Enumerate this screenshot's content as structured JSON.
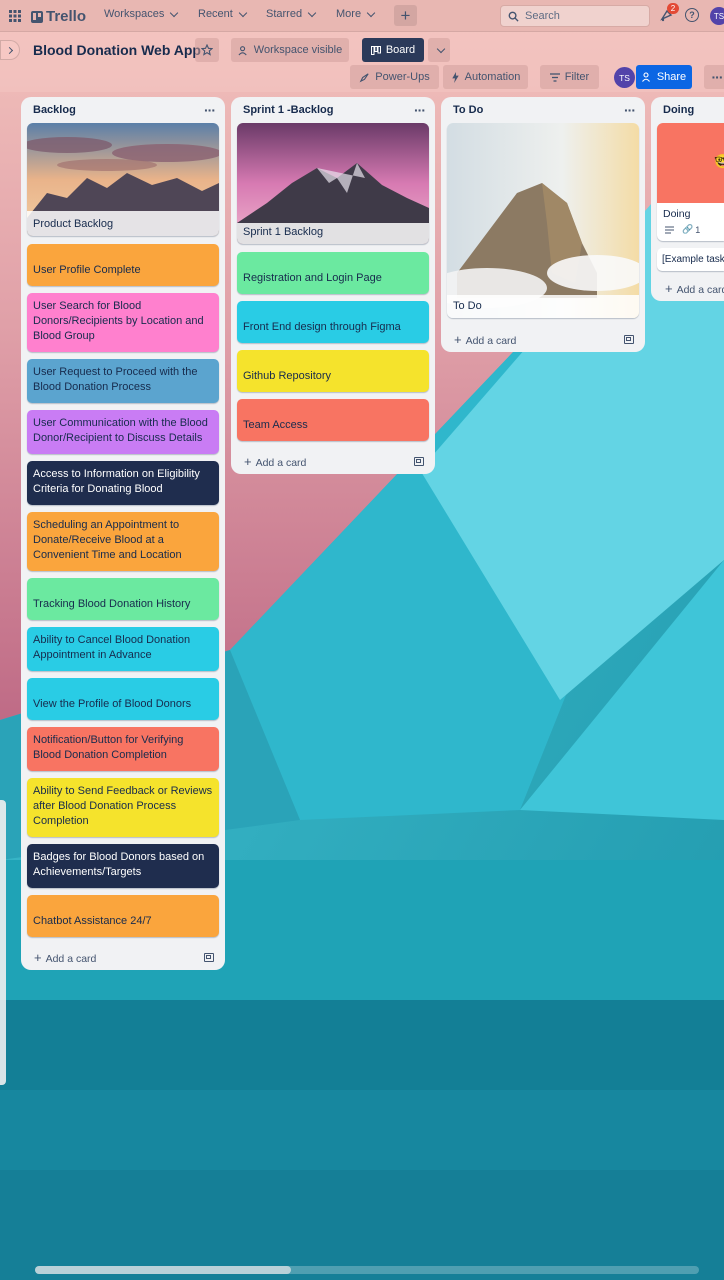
{
  "nav": {
    "brand": "Trello",
    "workspaces": "Workspaces",
    "recent": "Recent",
    "starred": "Starred",
    "more": "More",
    "search_placeholder": "Search",
    "notification_count": "2",
    "avatar_initials": "TS"
  },
  "board": {
    "title": "Blood Donation Web App",
    "visibility": "Workspace visible",
    "view": "Board",
    "power_ups": "Power-Ups",
    "automation": "Automation",
    "filter": "Filter",
    "member_initials": "TS",
    "share": "Share"
  },
  "lists": [
    {
      "title": "Backlog",
      "cover_label": "Product Backlog",
      "cards": [
        {
          "text": "User Profile Complete",
          "color": "#faa53d"
        },
        {
          "text": "User Search for Blood Donors/Recipients by Location and Blood Group",
          "color": "#ff80ce"
        },
        {
          "text": "User Request to Proceed with the Blood Donation Process",
          "color": "#5ba4cf"
        },
        {
          "text": "User Communication with the Blood Donor/Recipient to Discuss Details",
          "color": "#c97cf4"
        },
        {
          "text": "Access to Information on Eligibility Criteria for Donating Blood",
          "color": "#1f2d4e"
        },
        {
          "text": "Scheduling an Appointment to Donate/Receive Blood at a Convenient Time and Location",
          "color": "#faa53d"
        },
        {
          "text": "Tracking Blood Donation History",
          "color": "#6be9a0"
        },
        {
          "text": "Ability to Cancel Blood Donation Appointment in Advance",
          "color": "#29cce5"
        },
        {
          "text": "View the Profile of Blood Donors",
          "color": "#29cce5"
        },
        {
          "text": "Notification/Button for Verifying Blood Donation Completion",
          "color": "#f87462"
        },
        {
          "text": "Ability to Send Feedback or Reviews after Blood Donation Process Completion",
          "color": "#f5e32c"
        },
        {
          "text": "Badges for Blood Donors based on Achievements/Targets",
          "color": "#1f2d4e"
        },
        {
          "text": "Chatbot Assistance 24/7",
          "color": "#faa53d"
        }
      ],
      "add_label": "Add a card"
    },
    {
      "title": "Sprint 1 -Backlog",
      "cover_label": "Sprint 1 Backlog",
      "cards": [
        {
          "text": "Registration and Login Page",
          "color": "#6be9a0"
        },
        {
          "text": "Front End design through Figma",
          "color": "#29cce5"
        },
        {
          "text": "Github Repository",
          "color": "#f5e32c"
        },
        {
          "text": "Team Access",
          "color": "#f87462"
        }
      ],
      "add_label": "Add a card"
    },
    {
      "title": "To Do",
      "cover_label": "To Do",
      "cards": [],
      "add_label": "Add a card"
    },
    {
      "title": "Doing",
      "cover_label": "Doing",
      "cover_color": "#f87462",
      "cover_emoji": "🤓",
      "badge_attachments": "1",
      "cards": [
        {
          "text": "[Example task]",
          "color": "#ffffff"
        }
      ],
      "add_label": "Add a card"
    }
  ]
}
